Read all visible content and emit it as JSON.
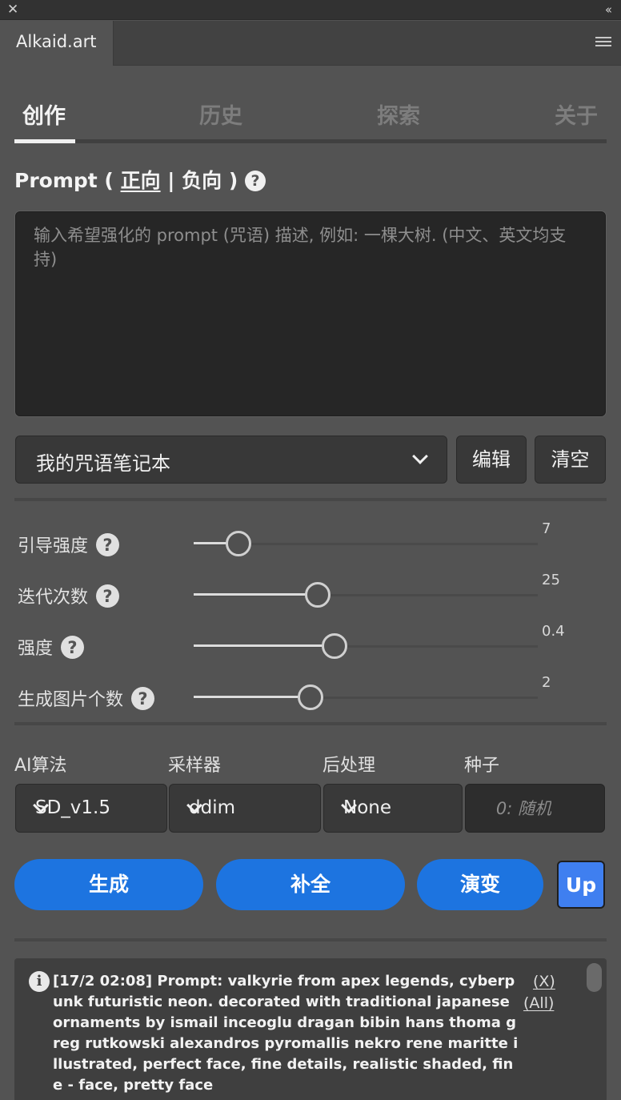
{
  "window": {
    "close_glyph": "✕",
    "collapse_glyph": "‹‹"
  },
  "panel_tab": {
    "title": "Alkaid.art",
    "menu_icon": "hamburger-icon"
  },
  "nav_tabs": [
    {
      "label": "创作",
      "active": true
    },
    {
      "label": "历史",
      "active": false
    },
    {
      "label": "探索",
      "active": false
    },
    {
      "label": "关于",
      "active": false
    }
  ],
  "prompt": {
    "heading_prefix": "Prompt ( ",
    "positive_label": "正向",
    "separator": " | ",
    "negative_label": "负向",
    "heading_suffix": " )",
    "help_glyph": "?",
    "placeholder": "输入希望强化的 prompt (咒语) 描述, 例如: 一棵大树. (中文、英文均支持)",
    "value": ""
  },
  "notebook": {
    "selected": "我的咒语笔记本",
    "edit_label": "编辑",
    "clear_label": "清空"
  },
  "sliders": [
    {
      "label": "引导强度",
      "value": "7",
      "fraction": 0.13
    },
    {
      "label": "迭代次数",
      "value": "25",
      "fraction": 0.36
    },
    {
      "label": "强度",
      "value": "0.4",
      "fraction": 0.41
    },
    {
      "label": "生成图片个数",
      "value": "2",
      "fraction": 0.34
    }
  ],
  "params": {
    "algo_label": "AI算法",
    "algo_value": "SD_v1.5",
    "sampler_label": "采样器",
    "sampler_value": "ddim",
    "post_label": "后处理",
    "post_value": "None",
    "seed_label": "种子",
    "seed_placeholder": "0: 随机"
  },
  "actions": {
    "generate": "生成",
    "complete": "补全",
    "variation": "演变",
    "up": "Up"
  },
  "log": {
    "text": "[17/2 02:08] Prompt: valkyrie from apex legends, cyberpunk futuristic neon. decorated with traditional japanese ornaments by ismail inceoglu dragan bibin hans thoma greg rutkowski alexandros pyromallis nekro rene maritte illustrated, perfect face, fine details, realistic shaded, fine - face, pretty face",
    "close_link": "(X)",
    "all_link": "(All)"
  },
  "colors": {
    "panel_bg": "#535353",
    "accent_blue": "#1d74e0",
    "up_button": "#3f7ff0",
    "text_primary": "#f0f0f0"
  }
}
